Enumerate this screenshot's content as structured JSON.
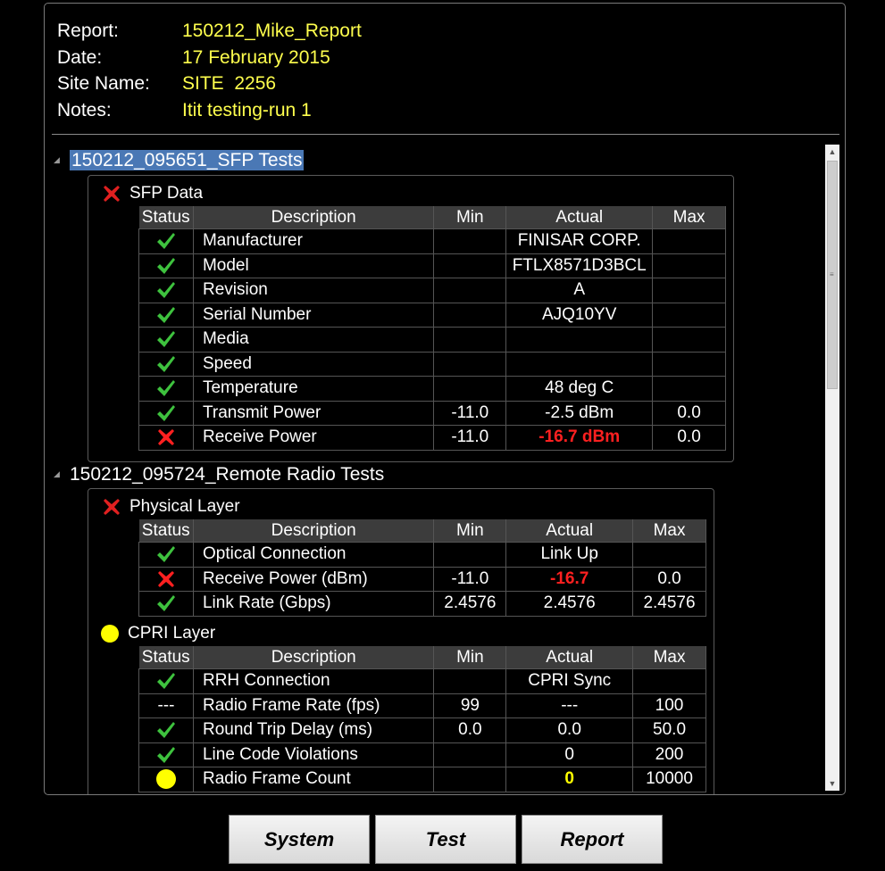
{
  "header": {
    "report_label": "Report:",
    "report_value": "150212_Mike_Report",
    "date_label": "Date:",
    "date_value": "17 February 2015",
    "site_label": "Site Name:",
    "site_value": "SITE  2256",
    "notes_label": "Notes:",
    "notes_value": "Itit testing-run 1"
  },
  "groups": [
    {
      "title": "150212_095651_SFP Tests",
      "sections": [
        {
          "title": "SFP Data",
          "status": "fail",
          "columns": [
            "Status",
            "Description",
            "Min",
            "Actual",
            "Max"
          ],
          "rows": [
            {
              "status": "pass",
              "description": "Manufacturer",
              "min": "",
              "actual": "FINISAR CORP.",
              "max": "",
              "actual_style": ""
            },
            {
              "status": "pass",
              "description": "Model",
              "min": "",
              "actual": "FTLX8571D3BCL",
              "max": "",
              "actual_style": ""
            },
            {
              "status": "pass",
              "description": "Revision",
              "min": "",
              "actual": "A",
              "max": "",
              "actual_style": ""
            },
            {
              "status": "pass",
              "description": "Serial Number",
              "min": "",
              "actual": "AJQ10YV",
              "max": "",
              "actual_style": ""
            },
            {
              "status": "pass",
              "description": "Media",
              "min": "",
              "actual": "",
              "max": "",
              "actual_style": ""
            },
            {
              "status": "pass",
              "description": "Speed",
              "min": "",
              "actual": "",
              "max": "",
              "actual_style": ""
            },
            {
              "status": "pass",
              "description": "Temperature",
              "min": "",
              "actual": "48 deg C",
              "max": "",
              "actual_style": ""
            },
            {
              "status": "pass",
              "description": "Transmit Power",
              "min": "-11.0",
              "actual": "-2.5 dBm",
              "max": "0.0",
              "actual_style": ""
            },
            {
              "status": "fail",
              "description": "Receive Power",
              "min": "-11.0",
              "actual": "-16.7 dBm",
              "max": "0.0",
              "actual_style": "fail"
            }
          ]
        }
      ]
    },
    {
      "title": "150212_095724_Remote Radio Tests",
      "sections": [
        {
          "title": "Physical Layer",
          "status": "fail",
          "columns": [
            "Status",
            "Description",
            "Min",
            "Actual",
            "Max"
          ],
          "rows": [
            {
              "status": "pass",
              "description": "Optical Connection",
              "min": "",
              "actual": "Link Up",
              "max": "",
              "actual_style": ""
            },
            {
              "status": "fail",
              "description": "Receive Power (dBm)",
              "min": "-11.0",
              "actual": "-16.7",
              "max": "0.0",
              "actual_style": "fail"
            },
            {
              "status": "pass",
              "description": "Link Rate (Gbps)",
              "min": "2.4576",
              "actual": "2.4576",
              "max": "2.4576",
              "actual_style": ""
            }
          ]
        },
        {
          "title": "CPRI Layer",
          "status": "warn",
          "columns": [
            "Status",
            "Description",
            "Min",
            "Actual",
            "Max"
          ],
          "rows": [
            {
              "status": "pass",
              "description": "RRH Connection",
              "min": "",
              "actual": "CPRI Sync",
              "max": "",
              "actual_style": ""
            },
            {
              "status": "none",
              "status_text": "---",
              "description": "Radio Frame Rate (fps)",
              "min": "99",
              "actual": "---",
              "max": "100",
              "actual_style": ""
            },
            {
              "status": "pass",
              "description": "Round Trip Delay (ms)",
              "min": "0.0",
              "actual": "0.0",
              "max": "50.0",
              "actual_style": ""
            },
            {
              "status": "pass",
              "description": "Line Code Violations",
              "min": "",
              "actual": "0",
              "max": "200",
              "actual_style": ""
            },
            {
              "status": "warn",
              "description": "Radio Frame Count",
              "min": "",
              "actual": "0",
              "max": "10000",
              "actual_style": "warn"
            }
          ]
        }
      ]
    }
  ],
  "buttons": {
    "system": "System",
    "test": "Test",
    "report": "Report"
  },
  "colors": {
    "header_value": "#ffff4d",
    "fail": "#ff2020",
    "pass": "#3ec23e",
    "warn": "#ffff00",
    "selection": "#4a78b5"
  },
  "icons": {
    "pass": "check-icon",
    "fail": "x-icon",
    "warn": "yellow-circle-icon",
    "expand": "triangle-expand-icon"
  }
}
